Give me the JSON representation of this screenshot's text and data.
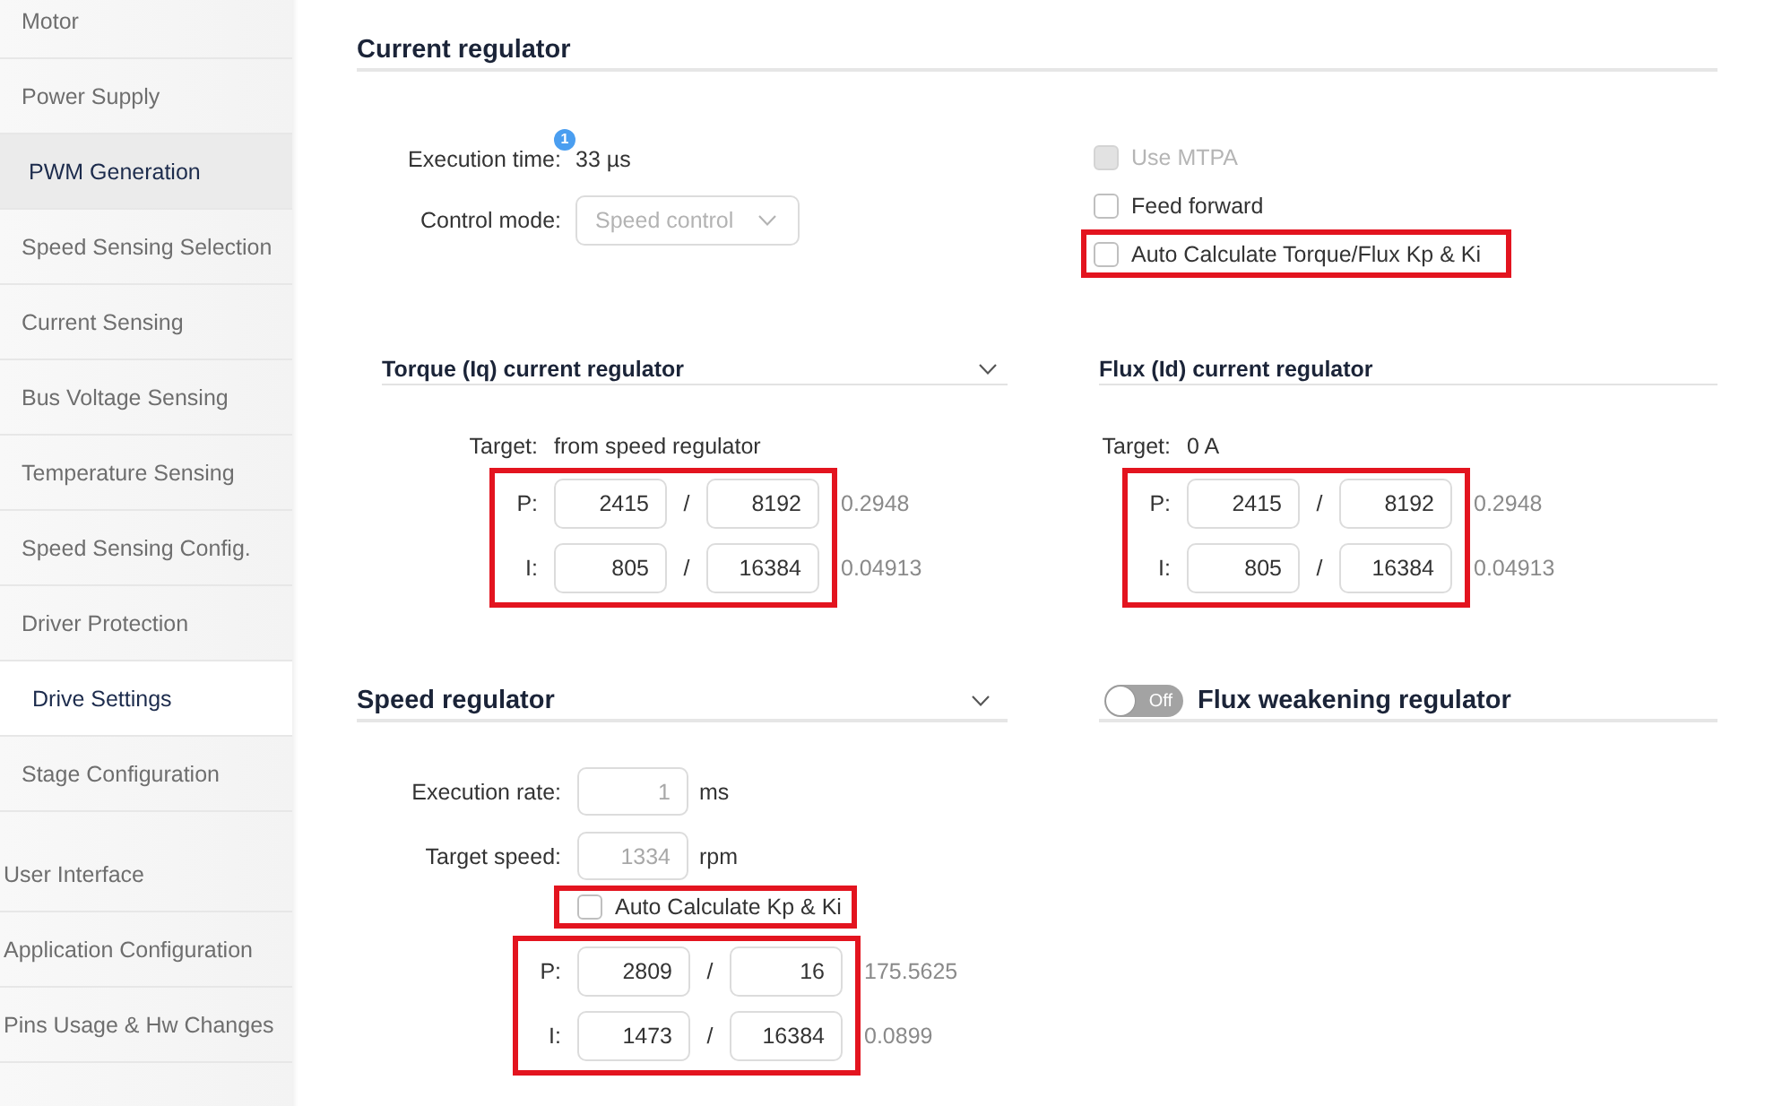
{
  "sidebar": {
    "groups": [
      {
        "kind": "sub",
        "items": [
          {
            "label": "Motor",
            "selected": false,
            "hovered": false
          },
          {
            "label": "Power Supply",
            "selected": false,
            "hovered": false
          },
          {
            "label": "PWM Generation",
            "selected": false,
            "hovered": true
          },
          {
            "label": "Speed Sensing Selection",
            "selected": false,
            "hovered": false
          },
          {
            "label": "Current Sensing",
            "selected": false,
            "hovered": false
          },
          {
            "label": "Bus Voltage Sensing",
            "selected": false,
            "hovered": false
          },
          {
            "label": "Temperature Sensing",
            "selected": false,
            "hovered": false
          },
          {
            "label": "Speed Sensing Config.",
            "selected": false,
            "hovered": false
          },
          {
            "label": "Driver Protection",
            "selected": false,
            "hovered": false
          },
          {
            "label": "Drive Settings",
            "selected": true,
            "hovered": false
          },
          {
            "label": "Stage Configuration",
            "selected": false,
            "hovered": false
          }
        ]
      },
      {
        "kind": "main",
        "items": [
          {
            "label": "User Interface",
            "selected": false,
            "hovered": false
          },
          {
            "label": "Application Configuration",
            "selected": false,
            "hovered": false
          },
          {
            "label": "Pins Usage & Hw Changes",
            "selected": false,
            "hovered": false
          }
        ]
      }
    ]
  },
  "current_regulator": {
    "title": "Current regulator",
    "execution_time": {
      "label": "Execution time:",
      "value": "33 µs",
      "badge": "1"
    },
    "control_mode": {
      "label": "Control mode:",
      "value": "Speed control",
      "disabled": true
    },
    "options": [
      {
        "label": "Use MTPA",
        "checked": false,
        "disabled": true,
        "annotated": false
      },
      {
        "label": "Feed forward",
        "checked": false,
        "disabled": false,
        "annotated": false
      },
      {
        "label": "Auto Calculate Torque/Flux Kp & Ki",
        "checked": false,
        "disabled": false,
        "annotated": true
      }
    ]
  },
  "torque_regulator": {
    "title": "Torque (Iq) current regulator",
    "collapsible": true,
    "target": {
      "label": "Target:",
      "value": "from speed regulator"
    },
    "gains": {
      "annotated": true,
      "rows": [
        {
          "label": "P:",
          "numerator": "2415",
          "separator": "/",
          "denominator": "8192",
          "result": "0.2948"
        },
        {
          "label": "I:",
          "numerator": "805",
          "separator": "/",
          "denominator": "16384",
          "result": "0.04913"
        }
      ]
    }
  },
  "flux_regulator": {
    "title": "Flux (Id) current regulator",
    "collapsible": false,
    "target": {
      "label": "Target:",
      "value": "0 A"
    },
    "gains": {
      "annotated": true,
      "rows": [
        {
          "label": "P:",
          "numerator": "2415",
          "separator": "/",
          "denominator": "8192",
          "result": "0.2948"
        },
        {
          "label": "I:",
          "numerator": "805",
          "separator": "/",
          "denominator": "16384",
          "result": "0.04913"
        }
      ]
    }
  },
  "speed_regulator": {
    "title": "Speed regulator",
    "collapsible": true,
    "execution_rate": {
      "label": "Execution rate:",
      "value": "1",
      "unit": "ms",
      "disabled": true
    },
    "target_speed": {
      "label": "Target speed:",
      "value": "1334",
      "unit": "rpm",
      "disabled": true
    },
    "auto_calculate": {
      "label": "Auto Calculate Kp & Ki",
      "checked": false,
      "disabled": false,
      "annotated": true
    },
    "gains": {
      "annotated": true,
      "rows": [
        {
          "label": "P:",
          "numerator": "2809",
          "separator": "/",
          "denominator": "16",
          "result": "175.5625"
        },
        {
          "label": "I:",
          "numerator": "1473",
          "separator": "/",
          "denominator": "16384",
          "result": "0.0899"
        }
      ]
    }
  },
  "flux_weakening": {
    "title": "Flux weakening regulator",
    "toggle": {
      "on": false,
      "label": "Off"
    }
  }
}
